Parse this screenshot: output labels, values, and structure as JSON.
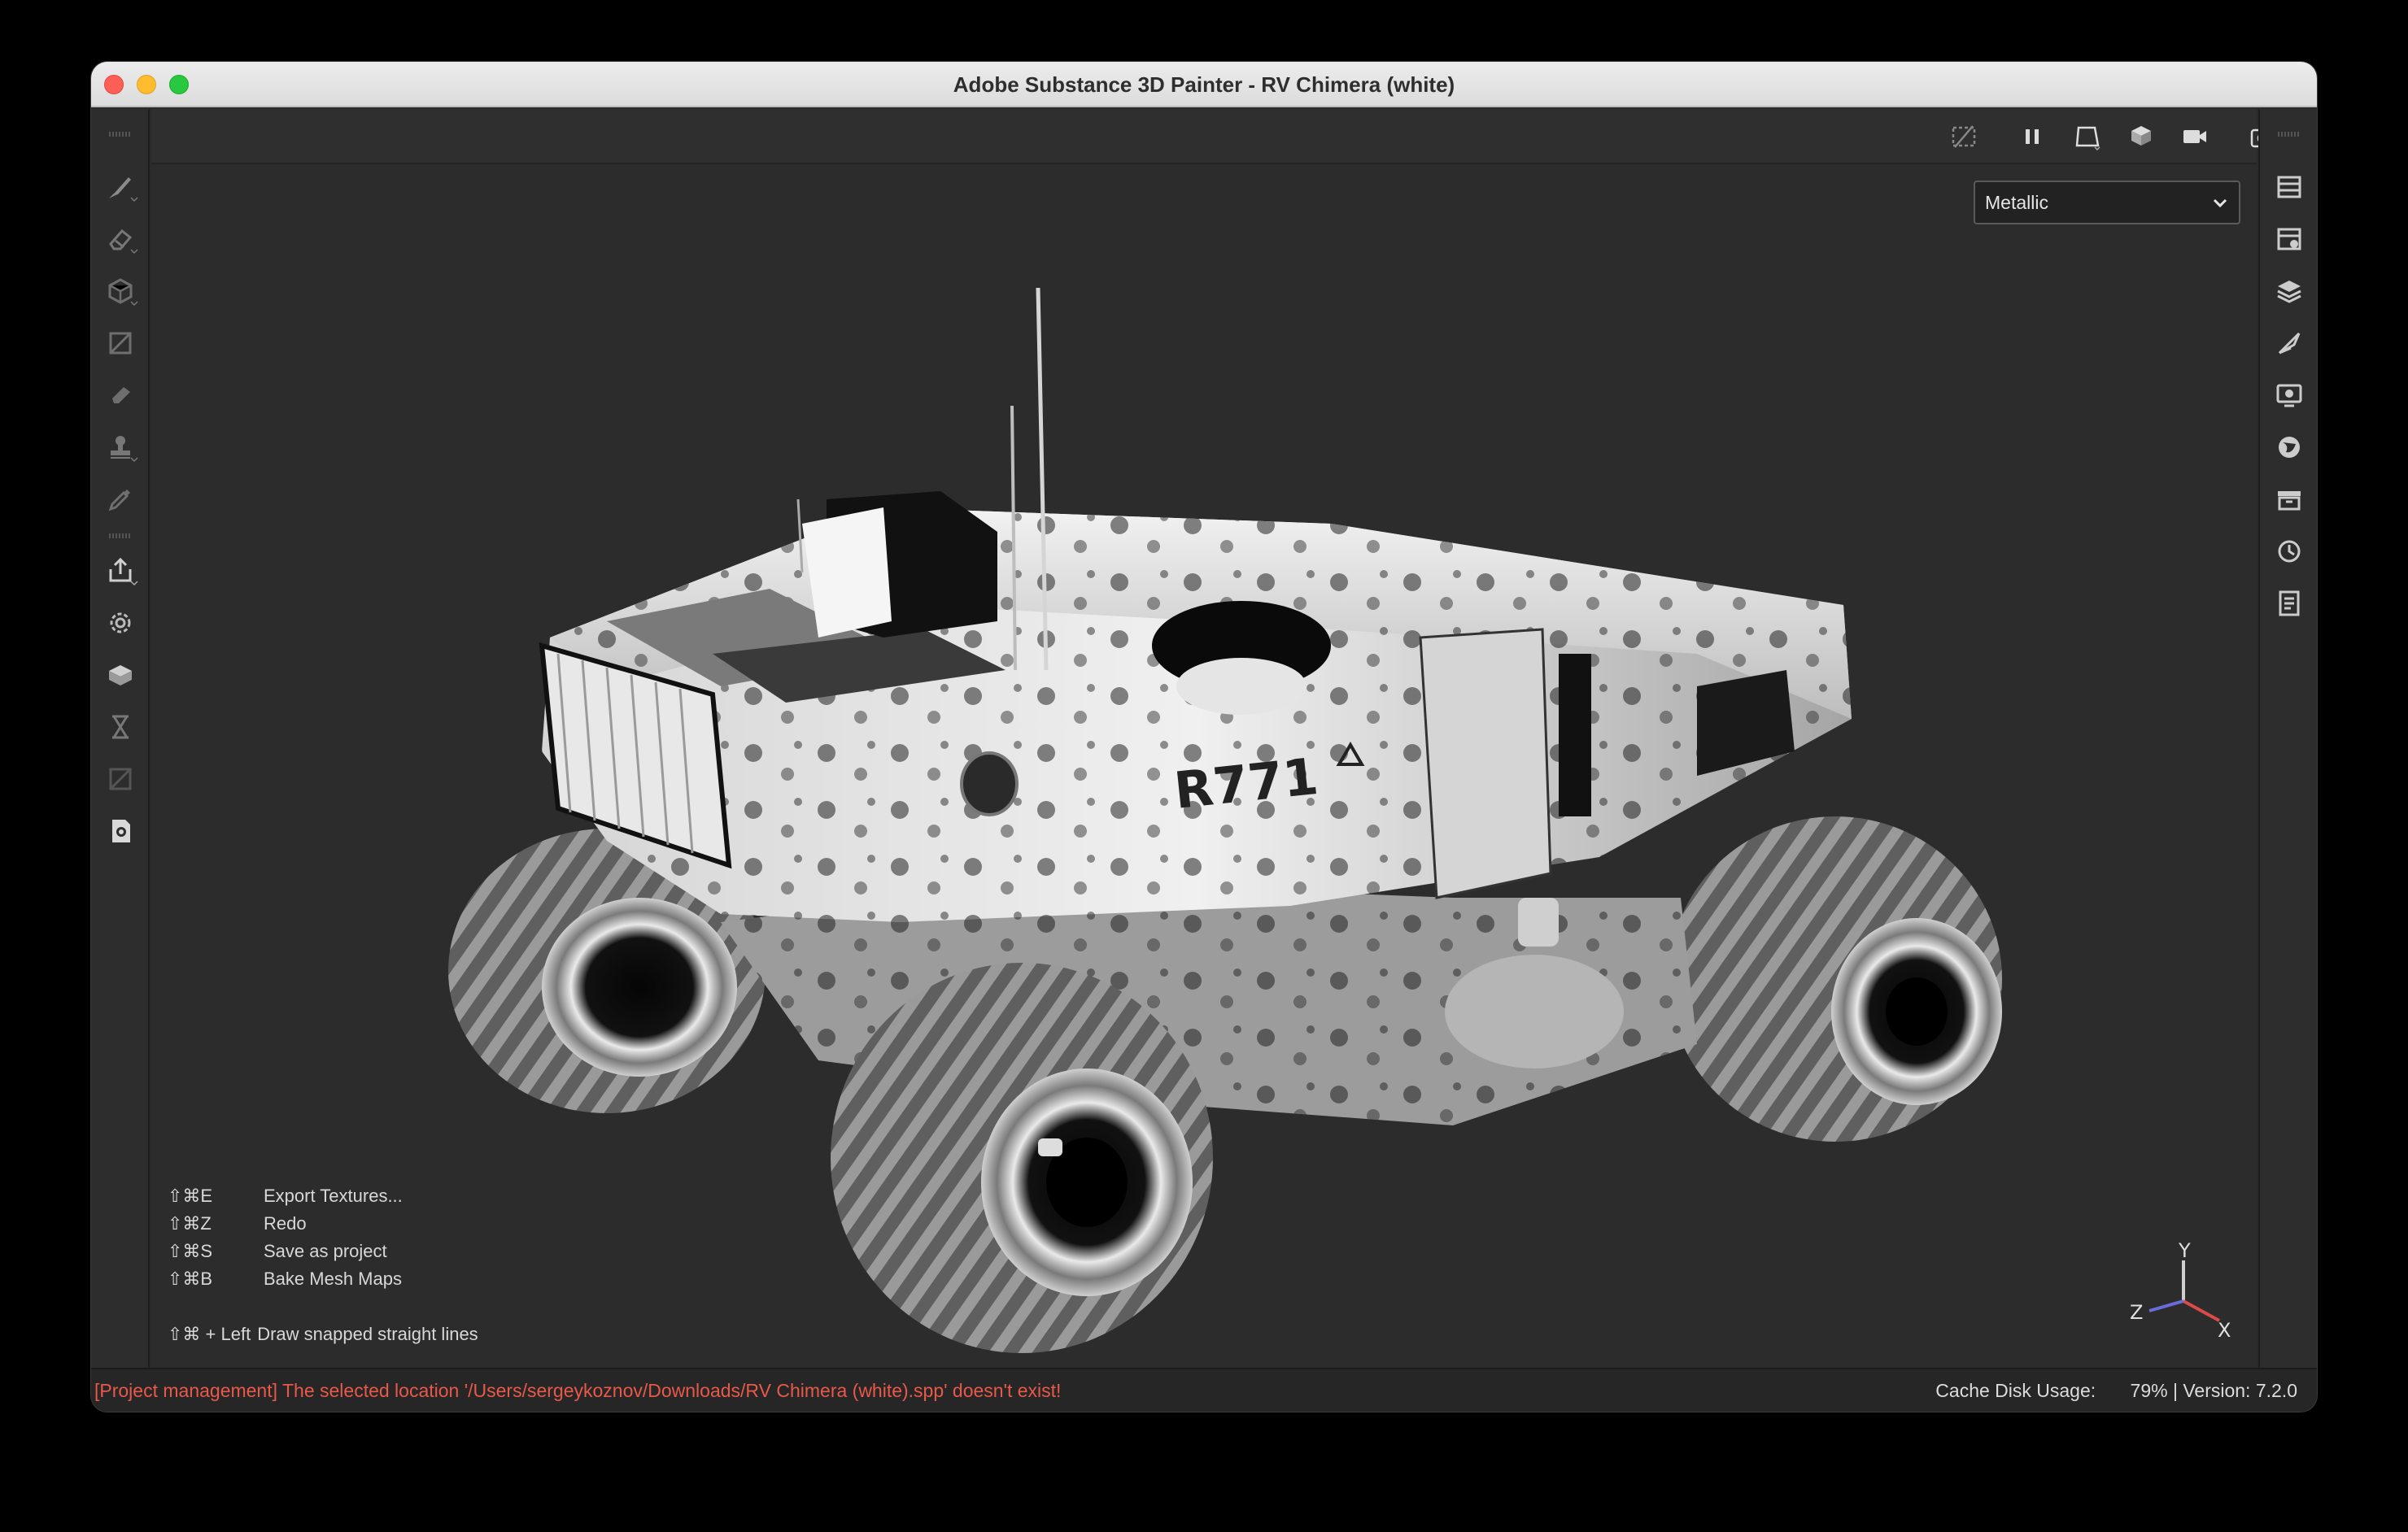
{
  "window": {
    "title": "Adobe Substance 3D Painter - RV Chimera (white)"
  },
  "left_tools": [
    {
      "icon": "paint-brush-icon"
    },
    {
      "icon": "eraser-icon"
    },
    {
      "icon": "projection-icon"
    },
    {
      "icon": "geometry-mask-icon"
    },
    {
      "icon": "smudge-icon"
    },
    {
      "icon": "clone-stamp-icon"
    },
    {
      "icon": "color-picker-icon"
    },
    {
      "icon": "export-icon"
    },
    {
      "icon": "settings-gear-icon"
    },
    {
      "icon": "bake-mesh-icon"
    },
    {
      "icon": "hourglass-icon"
    },
    {
      "icon": "uv-icon"
    },
    {
      "icon": "material-check-icon"
    }
  ],
  "right_panels": [
    {
      "icon": "texture-set-list-icon"
    },
    {
      "icon": "texture-set-settings-icon"
    },
    {
      "icon": "layers-icon"
    },
    {
      "icon": "properties-icon"
    },
    {
      "icon": "display-settings-icon"
    },
    {
      "icon": "environment-globe-icon"
    },
    {
      "icon": "shelf-icon"
    },
    {
      "icon": "history-icon"
    },
    {
      "icon": "log-icon"
    }
  ],
  "viewport_toolbar": [
    {
      "icon": "hide-ui-icon"
    },
    {
      "icon": "pause-icon"
    },
    {
      "icon": "view-2d-icon"
    },
    {
      "icon": "view-3d-cube-icon"
    },
    {
      "icon": "camera-icon"
    },
    {
      "icon": "screenshot-icon"
    }
  ],
  "channel_dropdown": {
    "selected": "Metallic"
  },
  "shortcuts": [
    {
      "keys": "⇧⌘E",
      "action": "Export Textures..."
    },
    {
      "keys": "⇧⌘Z",
      "action": "Redo"
    },
    {
      "keys": "⇧⌘S",
      "action": "Save as project"
    },
    {
      "keys": "⇧⌘B",
      "action": "Bake Mesh Maps"
    },
    {
      "keys": "⇧⌘ + Left",
      "action": "Draw snapped straight lines"
    }
  ],
  "model": {
    "decal_text": "R771"
  },
  "gizmo": {
    "x": "X",
    "y": "Y",
    "z": "Z",
    "colors": {
      "x": "#d94a4a",
      "y": "#cfcfcf",
      "z": "#6b6bd9"
    }
  },
  "status": {
    "error": "[Project management] The selected location '/Users/sergeykoznov/Downloads/RV Chimera (white).spp' doesn't exist!",
    "cache_label": "Cache Disk Usage:",
    "cache_value": "79% | Version: 7.2.0",
    "error_color": "#e8594a"
  }
}
